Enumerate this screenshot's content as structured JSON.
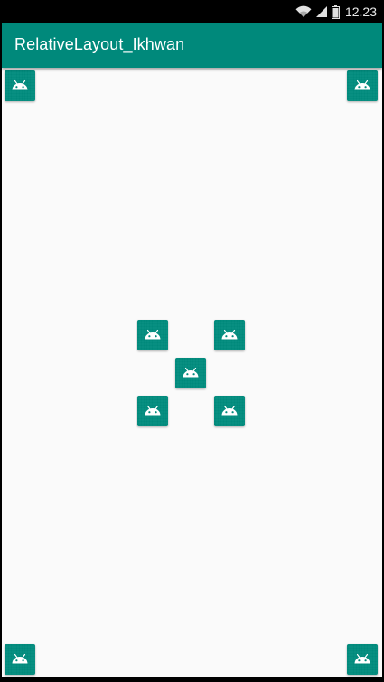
{
  "status_bar": {
    "time": "12.23",
    "icons": [
      "wifi-icon",
      "signal-icon",
      "battery-icon"
    ]
  },
  "app_bar": {
    "title": "RelativeLayout_Ikhwan",
    "color": "#00897b"
  },
  "content": {
    "background": "#fafafa",
    "launcher_icon": "android-launcher-icon",
    "image_views": [
      "image-top-left",
      "image-top-right",
      "image-center-upper-left",
      "image-center-upper-right",
      "image-center",
      "image-center-lower-left",
      "image-center-lower-right",
      "image-bottom-left",
      "image-bottom-right"
    ]
  }
}
